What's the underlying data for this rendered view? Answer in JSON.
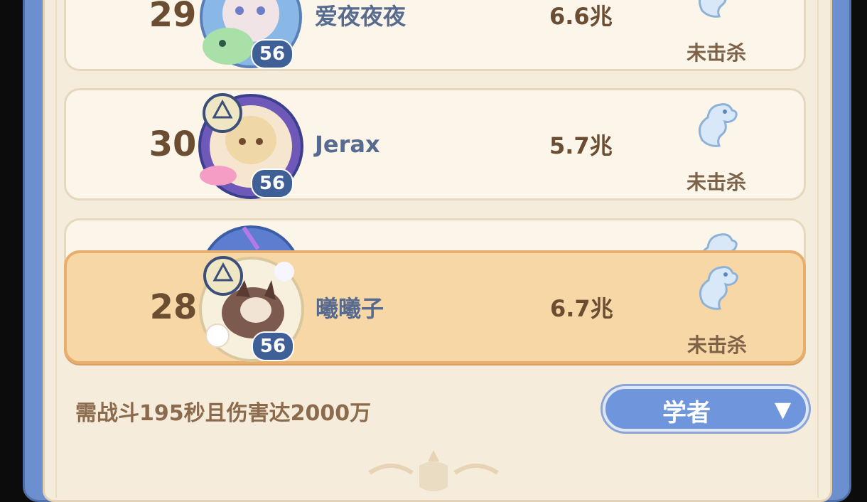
{
  "leaderboard": {
    "rows": [
      {
        "rank": "29",
        "name": "爱夜夜夜",
        "damage": "6.6兆",
        "level": "56",
        "status": "未击杀"
      },
      {
        "rank": "30",
        "name": "Jerax",
        "damage": "5.7兆",
        "level": "56",
        "status": "未击杀"
      },
      {
        "rank": "",
        "name": "",
        "damage": "",
        "level": "",
        "status": ""
      }
    ],
    "self_row": {
      "rank": "28",
      "name": "曦曦子",
      "damage": "6.7兆",
      "level": "56",
      "status": "未击杀"
    }
  },
  "requirement_text": "需战斗195秒且伤害达2000万",
  "class_select": {
    "label": "学者",
    "arrow": "▼"
  },
  "colors": {
    "panel_bg": "#f5ecdc",
    "self_row_bg": "#f8d7a6",
    "accent_blue": "#6f96dc"
  },
  "icons": [
    "dragon-icon",
    "emblem-icon",
    "dropdown-arrow-icon"
  ]
}
